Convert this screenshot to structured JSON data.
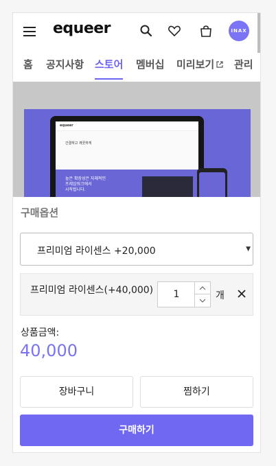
{
  "header": {
    "logo": "equeer",
    "avatar_text": "INAX"
  },
  "tabs": [
    {
      "label": "홈"
    },
    {
      "label": "공지사항"
    },
    {
      "label": "스토어",
      "active": true
    },
    {
      "label": "멤버십"
    },
    {
      "label": "미리보기"
    },
    {
      "label": "관리"
    }
  ],
  "banner": {
    "screen_logo": "equeer",
    "screen_title": "간결하고 깨끗하게",
    "screen_subtitle": "높은 확장성은 자체적인\n프레임워크에서\n시작됩니다."
  },
  "purchase_options": {
    "title": "구매옵션",
    "selected_option": "프리미엄 라이센스 +20,000",
    "item": {
      "label": "프리미엄 라이센스(+40,000)",
      "quantity": "1",
      "unit": "개"
    }
  },
  "price": {
    "label": "상품금액:",
    "value": "40,000"
  },
  "actions": {
    "cart_label": "장바구니",
    "wishlist_label": "찜하기",
    "buy_label": "구매하기"
  },
  "colors": {
    "accent": "#7168f2",
    "banner_purple": "#6967d8"
  },
  "icons": [
    "menu-icon",
    "search-icon",
    "heart-icon",
    "shopping-bag-icon",
    "external-link-icon",
    "chevron-up-icon",
    "chevron-down-icon",
    "close-icon"
  ]
}
